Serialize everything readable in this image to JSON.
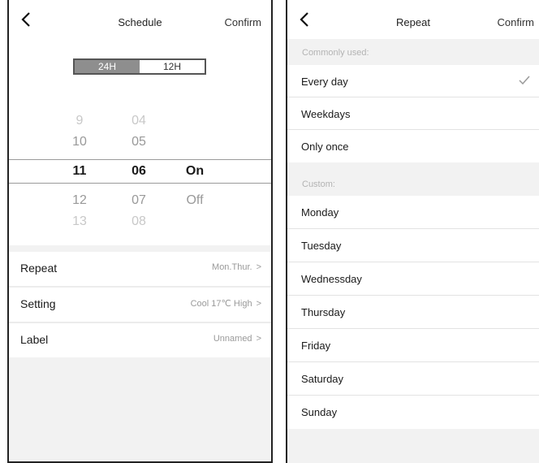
{
  "schedule": {
    "title": "Schedule",
    "confirm": "Confirm",
    "mode_24h": "24H",
    "mode_12h": "12H",
    "active_mode": "24H",
    "hours": [
      "9",
      "10",
      "11",
      "12",
      "13"
    ],
    "minutes": [
      "04",
      "05",
      "06",
      "07",
      "08"
    ],
    "states": [
      "On",
      "Off"
    ],
    "selected": {
      "hour": "11",
      "minute": "06",
      "state": "On"
    },
    "settings": [
      {
        "label": "Repeat",
        "value": "Mon.Thur."
      },
      {
        "label": "Setting",
        "value": "Cool 17℃ High"
      },
      {
        "label": "Label",
        "value": "Unnamed"
      }
    ],
    "chevron": ">"
  },
  "repeat": {
    "title": "Repeat",
    "confirm": "Confirm",
    "common_header": "Commonly used:",
    "common_options": [
      {
        "label": "Every day",
        "checked": true
      },
      {
        "label": "Weekdays",
        "checked": false
      },
      {
        "label": "Only once",
        "checked": false
      }
    ],
    "custom_header": "Custom:",
    "custom_options": [
      "Monday",
      "Tuesday",
      "Wednessday",
      "Thursday",
      "Friday",
      "Saturday",
      "Sunday"
    ]
  },
  "icons": {
    "back": "chevron-left-icon",
    "check": "checkmark-icon"
  },
  "colors": {
    "toggle_active": "#8e8e8e",
    "divider": "#e3e3e3",
    "muted_text": "#9a9a9a"
  }
}
